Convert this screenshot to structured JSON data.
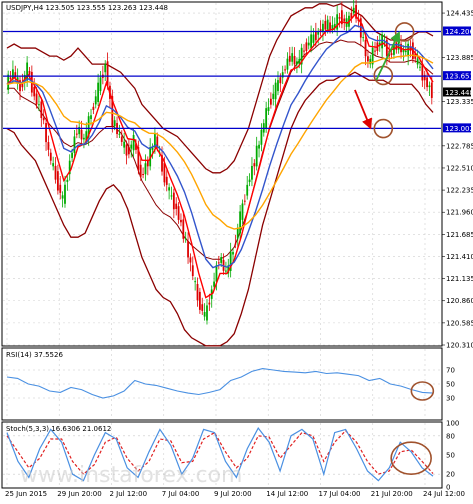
{
  "chart_data": [
    {
      "type": "candlestick",
      "symbol": "USDJPY",
      "timeframe": "H4",
      "ohlc_header": "USDJPY,H4  123.505 123.555 123.263 123.448",
      "ylim": [
        120.31,
        124.56
      ],
      "y_ticks": [
        124.435,
        124.206,
        123.885,
        123.651,
        123.448,
        123.335,
        123.002,
        122.785,
        122.51,
        122.235,
        121.96,
        121.685,
        121.41,
        121.135,
        120.86,
        120.585,
        120.31
      ],
      "x_tick_labels": [
        "25 Jun 2015",
        "29 Jun 20:00",
        "2 Jul 12:00",
        "7 Jul 04:00",
        "9 Jul 20:00",
        "14 Jul 12:00",
        "17 Jul 04:00",
        "21 Jul 20:00",
        "24 Jul 12:00"
      ],
      "horizontal_levels": [
        {
          "value": 124.206,
          "label": "124.206",
          "color": "#0000cc"
        },
        {
          "value": 123.651,
          "label": "123.651",
          "color": "#0000cc"
        },
        {
          "value": 123.002,
          "label": "123.002",
          "color": "#0000cc"
        }
      ],
      "current_price": {
        "value": 123.448,
        "label": "123.448"
      },
      "colors": {
        "up": "#00aa00",
        "down": "#dd0000",
        "bollinger": "#8b0000",
        "ema_fast": "#ff0000",
        "ema_mid": "#3355cc",
        "ema_slow": "#ffa500"
      },
      "price_path": [
        123.55,
        123.7,
        123.5,
        123.75,
        123.4,
        123.2,
        122.7,
        122.4,
        122.1,
        122.6,
        123.0,
        122.85,
        123.2,
        123.5,
        123.8,
        123.1,
        122.9,
        122.7,
        122.85,
        122.4,
        122.6,
        122.9,
        122.5,
        122.2,
        122.0,
        121.7,
        121.3,
        120.9,
        120.65,
        121.0,
        121.4,
        121.2,
        121.5,
        121.9,
        122.3,
        122.6,
        122.95,
        123.3,
        123.5,
        123.7,
        123.9,
        123.8,
        124.0,
        124.1,
        124.2,
        124.3,
        124.25,
        124.4,
        124.3,
        124.5,
        124.2,
        123.8,
        124.0,
        124.1,
        123.9,
        124.05,
        123.95,
        124.0,
        123.8,
        123.6,
        123.45
      ],
      "bollinger_upper": [
        124.0,
        124.05,
        124.0,
        124.0,
        124.0,
        123.95,
        123.9,
        123.9,
        123.85,
        123.9,
        124.0,
        123.9,
        123.8,
        123.8,
        123.8,
        123.75,
        123.7,
        123.6,
        123.5,
        123.3,
        123.2,
        123.1,
        123.0,
        122.95,
        122.9,
        122.8,
        122.7,
        122.6,
        122.5,
        122.45,
        122.45,
        122.5,
        122.6,
        122.8,
        123.0,
        123.3,
        123.6,
        123.9,
        124.1,
        124.25,
        124.4,
        124.45,
        124.5,
        124.5,
        124.55,
        124.55,
        124.52,
        124.55,
        124.5,
        124.45,
        124.4,
        124.3,
        124.2,
        124.15,
        124.1,
        124.1,
        124.1,
        124.15,
        124.2,
        124.2,
        124.15
      ],
      "bollinger_lower": [
        123.0,
        122.95,
        122.8,
        122.7,
        122.6,
        122.4,
        122.2,
        122.0,
        121.8,
        121.65,
        121.65,
        121.7,
        121.9,
        122.1,
        122.25,
        122.3,
        122.2,
        122.0,
        121.7,
        121.4,
        121.2,
        121.0,
        120.9,
        120.85,
        120.7,
        120.5,
        120.4,
        120.35,
        120.3,
        120.3,
        120.3,
        120.35,
        120.45,
        120.7,
        121.0,
        121.4,
        121.8,
        122.1,
        122.4,
        122.7,
        123.0,
        123.2,
        123.35,
        123.45,
        123.55,
        123.6,
        123.6,
        123.65,
        123.65,
        123.7,
        123.65,
        123.6,
        123.6,
        123.6,
        123.55,
        123.55,
        123.55,
        123.55,
        123.45,
        123.3,
        123.2
      ],
      "annotations": [
        {
          "type": "circle",
          "label": "target-up",
          "at": [
            56,
            124.2
          ]
        },
        {
          "type": "circle",
          "label": "resistance-test",
          "at": [
            53,
            123.66
          ]
        },
        {
          "type": "circle",
          "label": "target-down",
          "at": [
            53,
            123.0
          ]
        },
        {
          "type": "arrow",
          "color": "#33aa33",
          "from": [
            52,
            123.6
          ],
          "to": [
            55,
            124.15
          ]
        },
        {
          "type": "arrow",
          "color": "#dd0000",
          "from": [
            49,
            123.48
          ],
          "to": [
            51,
            123.05
          ]
        }
      ]
    },
    {
      "type": "line",
      "title": "RSI(14) 37.5526",
      "ylim": [
        0,
        100
      ],
      "y_ticks": [
        70,
        50,
        30
      ],
      "values": [
        60,
        58,
        50,
        47,
        40,
        38,
        45,
        42,
        35,
        30,
        33,
        40,
        55,
        50,
        48,
        44,
        40,
        37,
        35,
        38,
        42,
        55,
        60,
        68,
        72,
        70,
        68,
        67,
        66,
        68,
        65,
        66,
        64,
        62,
        55,
        58,
        50,
        47,
        42,
        38,
        37
      ],
      "annotations": [
        {
          "type": "circle",
          "label": "rsi-circle"
        }
      ]
    },
    {
      "type": "line",
      "title": "Stoch(5,3,3) 16.6306 21.0612",
      "ylim": [
        0,
        100
      ],
      "y_ticks": [
        100,
        80,
        50,
        20,
        0
      ],
      "series": [
        {
          "name": "%K",
          "values": [
            85,
            40,
            15,
            60,
            90,
            70,
            20,
            10,
            50,
            85,
            75,
            30,
            15,
            55,
            90,
            65,
            20,
            45,
            90,
            85,
            40,
            15,
            60,
            92,
            70,
            25,
            80,
            90,
            75,
            20,
            85,
            90,
            60,
            25,
            10,
            30,
            70,
            55,
            30,
            17
          ]
        },
        {
          "name": "%D",
          "values": [
            80,
            55,
            30,
            45,
            75,
            75,
            40,
            20,
            35,
            70,
            78,
            45,
            25,
            40,
            75,
            72,
            38,
            40,
            75,
            85,
            55,
            30,
            45,
            80,
            78,
            45,
            65,
            85,
            80,
            40,
            70,
            88,
            70,
            40,
            20,
            25,
            55,
            58,
            40,
            21
          ]
        }
      ],
      "annotations": [
        {
          "type": "circle",
          "label": "stoch-circle"
        }
      ]
    }
  ],
  "watermark": "www.instaforex.com"
}
